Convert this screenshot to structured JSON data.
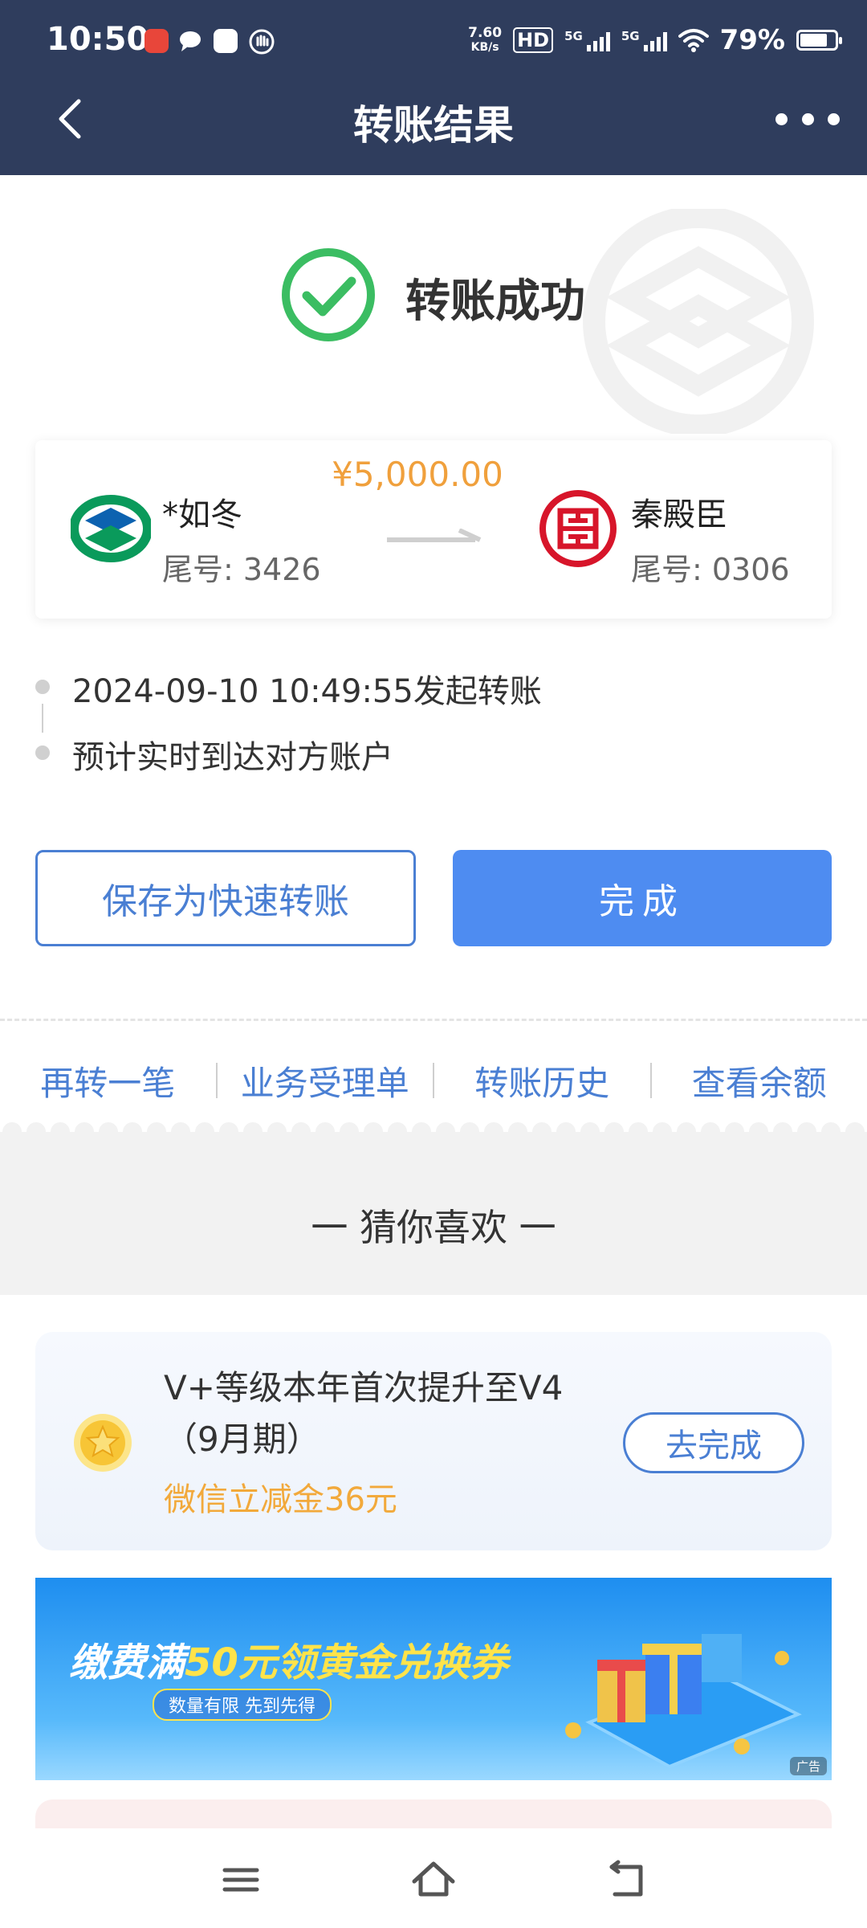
{
  "status_bar": {
    "time": "10:50",
    "net_speed_value": "7.60",
    "net_speed_unit": "KB/s",
    "hd_badge": "HD",
    "sim1_label": "5G",
    "sim2_label": "5G",
    "battery_percent": "79%",
    "battery_level": 0.79
  },
  "header": {
    "title": "转账结果",
    "back_icon": "chevron-left-icon",
    "more_icon": "more-dots-icon"
  },
  "result": {
    "status_text": "转账成功",
    "status_color": "#3bbd62"
  },
  "transfer": {
    "amount": "¥5,000.00",
    "payer": {
      "name": "*如冬",
      "tail": "尾号: 3426",
      "bank_icon": "ccb-bank-logo-icon",
      "color": "#0a9a5b"
    },
    "payee": {
      "name": "秦殿臣",
      "tail": "尾号: 0306",
      "bank_icon": "icbc-bank-logo-icon",
      "color": "#d7152a"
    }
  },
  "timeline": {
    "items": [
      "2024-09-10 10:49:55发起转账",
      "预计实时到达对方账户"
    ]
  },
  "actions": {
    "save_label": "保存为快速转账",
    "done_label": "完成"
  },
  "quick_links": [
    "再转一笔",
    "业务受理单",
    "转账历史",
    "查看余额"
  ],
  "recommend": {
    "title": "一 猜你喜欢 一",
    "task": {
      "title": "V+等级本年首次提升至V4（9月期）",
      "reward": "微信立减金36元",
      "button": "去完成",
      "icon": "star-coin-icon"
    },
    "banner": {
      "title_part1": "缴费满",
      "title_highlight": "50元",
      "title_part2": "领黄金兑换券",
      "subtitle": "数量有限 先到先得",
      "ad_tag": "广告"
    }
  },
  "nav_bar": {
    "menu_icon": "menu-icon",
    "home_icon": "home-icon",
    "back_icon": "back-icon"
  },
  "colors": {
    "header_bg": "#2f3d5d",
    "accent_blue": "#4e8cf1",
    "amount_orange": "#f0a03c"
  }
}
